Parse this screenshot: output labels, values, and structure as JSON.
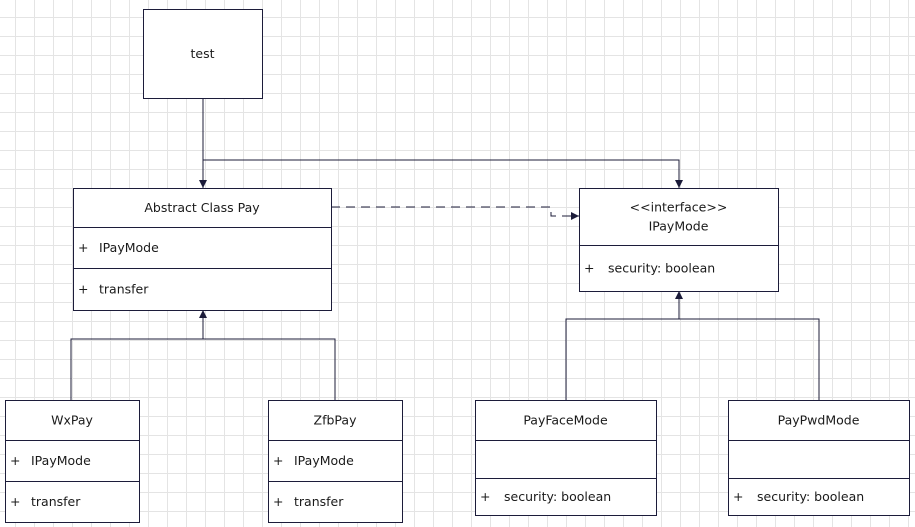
{
  "classes": {
    "test": {
      "title": [
        "test"
      ],
      "sections": []
    },
    "pay": {
      "title": [
        "Abstract Class Pay"
      ],
      "sections": [
        [
          "+",
          "IPayMode"
        ],
        [
          "+",
          "transfer"
        ]
      ]
    },
    "ipaymode": {
      "title": [
        "<<interface>>",
        "IPayMode"
      ],
      "sections": [
        [
          "+",
          "security:  boolean"
        ]
      ]
    },
    "wxpay": {
      "title": [
        "WxPay"
      ],
      "sections": [
        [
          "+",
          "IPayMode"
        ],
        [
          "+",
          "transfer"
        ]
      ]
    },
    "zfbpay": {
      "title": [
        "ZfbPay"
      ],
      "sections": [
        [
          "+",
          "IPayMode"
        ],
        [
          "+",
          "transfer"
        ]
      ]
    },
    "payface": {
      "title": [
        "PayFaceMode"
      ],
      "sections": [
        [
          "",
          ""
        ],
        [
          "+",
          "security:  boolean"
        ]
      ]
    },
    "paypwd": {
      "title": [
        "PayPwdMode"
      ],
      "sections": [
        [
          "",
          ""
        ],
        [
          "+",
          "security:  boolean"
        ]
      ]
    }
  },
  "colors": {
    "stroke": "#1c1c3a",
    "text": "#1a1a1a",
    "grid": "#e4e4e4"
  }
}
